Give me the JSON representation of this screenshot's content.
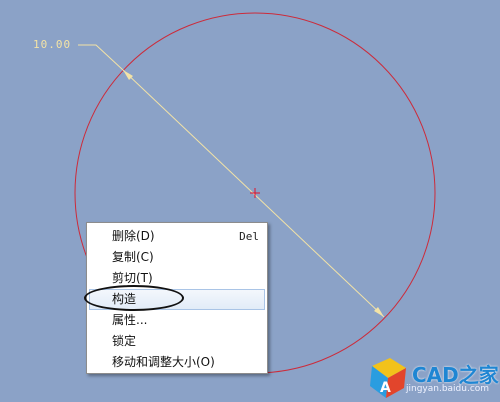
{
  "dimension": {
    "value_text": "10.00"
  },
  "context_menu": {
    "items": [
      {
        "label": "删除(D)",
        "shortcut": "Del"
      },
      {
        "label": "复制(C)",
        "shortcut": ""
      },
      {
        "label": "剪切(T)",
        "shortcut": ""
      },
      {
        "label": "构造",
        "shortcut": ""
      },
      {
        "label": "属性...",
        "shortcut": ""
      },
      {
        "label": "锁定",
        "shortcut": ""
      },
      {
        "label": "移动和调整大小(O)",
        "shortcut": ""
      }
    ]
  },
  "watermark": {
    "logo_text": "CAD之家",
    "url_text": "jingyan.baidu.com"
  },
  "colors": {
    "background": "#8ba2c7",
    "circle": "#cc2b3a",
    "dimension": "#f3e3a6",
    "center_mark": "#e0102a"
  }
}
